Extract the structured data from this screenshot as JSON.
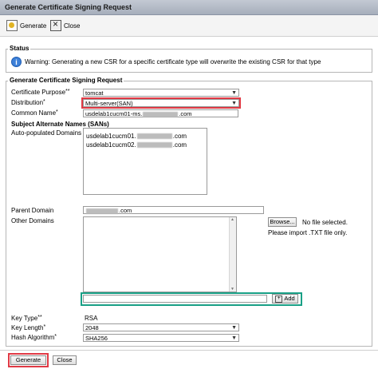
{
  "window": {
    "title": "Generate Certificate Signing Request"
  },
  "toolbar": {
    "generate_label": "Generate",
    "close_label": "Close"
  },
  "status": {
    "legend": "Status",
    "warning": "Warning: Generating a new CSR for a specific certificate type will overwrite the existing CSR for that type"
  },
  "csr": {
    "legend": "Generate Certificate Signing Request",
    "certificate_purpose": {
      "label": "Certificate Purpose",
      "req": "**",
      "value": "tomcat"
    },
    "distribution": {
      "label": "Distribution",
      "req": "*",
      "value": "Multi-server(SAN)"
    },
    "common_name": {
      "label": "Common Name",
      "req": "*",
      "prefix": "usdelab1cucm01-ms.",
      "suffix": ".com"
    },
    "sans_heading": "Subject Alternate Names (SANs)",
    "auto_domains": {
      "label": "Auto-populated Domains",
      "items": [
        {
          "prefix": "usdelab1cucm01.",
          "suffix": ".com"
        },
        {
          "prefix": "usdelab1cucm02.",
          "suffix": ".com"
        }
      ]
    },
    "parent_domain": {
      "label": "Parent Domain",
      "suffix": ".com"
    },
    "other_domains": {
      "label": "Other Domains",
      "browse_label": "Browse...",
      "file_status": "No file selected.",
      "import_note": "Please import .TXT file only.",
      "add_label": "Add",
      "add_value": ""
    },
    "key_type": {
      "label": "Key Type",
      "req": "**",
      "value": "RSA"
    },
    "key_length": {
      "label": "Key Length",
      "req": "*",
      "value": "2048"
    },
    "hash_algorithm": {
      "label": "Hash Algorithm",
      "req": "*",
      "value": "SHA256"
    }
  },
  "footer": {
    "generate_label": "Generate",
    "close_label": "Close"
  },
  "colors": {
    "highlight_red": "#e03a45",
    "highlight_teal": "#19a086",
    "info_blue": "#3d80d8"
  }
}
